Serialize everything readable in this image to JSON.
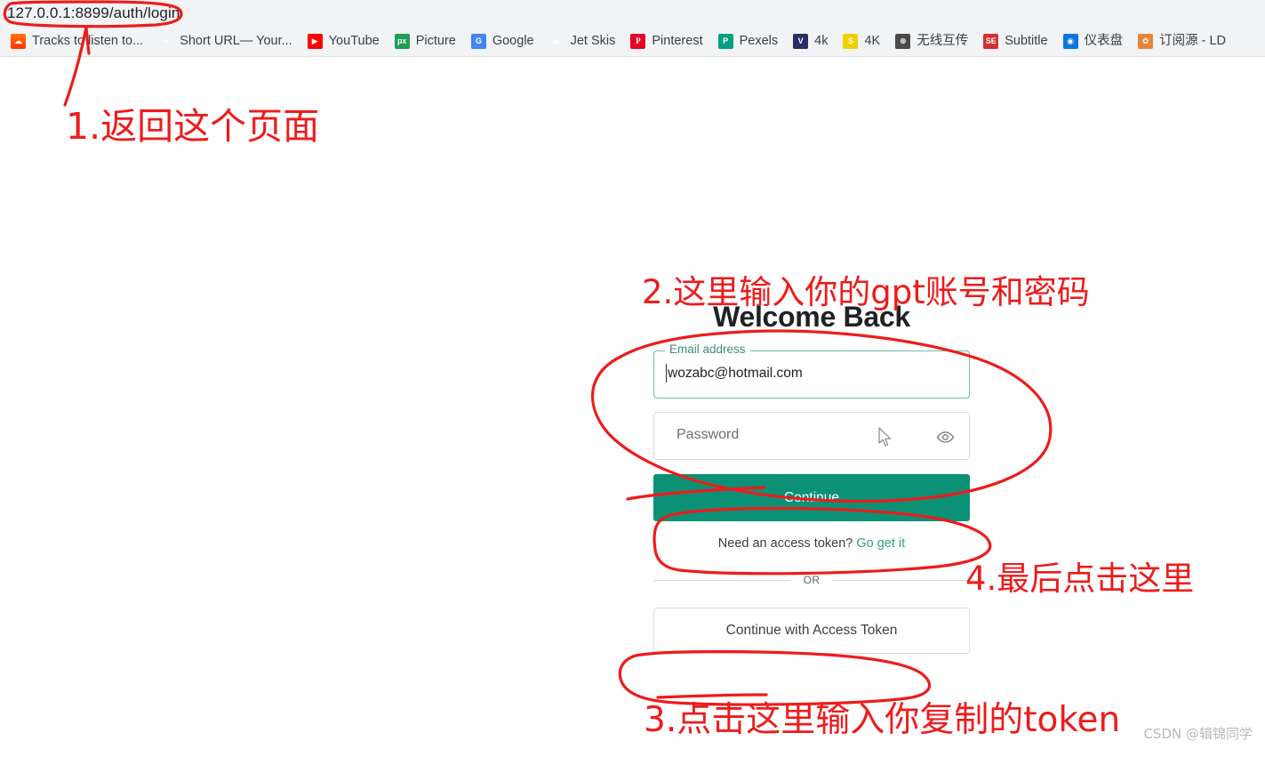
{
  "browser": {
    "url": "127.0.0.1:8899/auth/login",
    "bookmarks": [
      {
        "label": "Tracks to listen to...",
        "icon": "soundcloud-icon",
        "glyph": "☁",
        "cls": "fav-soundcloud"
      },
      {
        "label": "Short URL— Your...",
        "icon": "link-icon",
        "glyph": "∞",
        "cls": "fav-shorturl"
      },
      {
        "label": "YouTube",
        "icon": "youtube-icon",
        "glyph": "▶",
        "cls": "fav-youtube"
      },
      {
        "label": "Picture",
        "icon": "pexels-px-icon",
        "glyph": "px",
        "cls": "fav-picture"
      },
      {
        "label": "Google",
        "icon": "google-icon",
        "glyph": "G",
        "cls": "fav-google"
      },
      {
        "label": "Jet Skis",
        "icon": "play-icon",
        "glyph": "▶",
        "cls": "fav-jetski"
      },
      {
        "label": "Pinterest",
        "icon": "pinterest-icon",
        "glyph": "P",
        "cls": "fav-pinterest"
      },
      {
        "label": "Pexels",
        "icon": "pexels-icon",
        "glyph": "P",
        "cls": "fav-pexels"
      },
      {
        "label": "4k",
        "icon": "v-icon",
        "glyph": "V",
        "cls": "fav-4kv"
      },
      {
        "label": "4K",
        "icon": "s-badge-icon",
        "glyph": "S",
        "cls": "fav-4ks"
      },
      {
        "label": "无线互传",
        "icon": "globe-icon",
        "glyph": "⊕",
        "cls": "fav-wireless"
      },
      {
        "label": "Subtitle",
        "icon": "subtitle-icon",
        "glyph": "SE",
        "cls": "fav-subtitle"
      },
      {
        "label": "仪表盘",
        "icon": "dashboard-icon",
        "glyph": "◉",
        "cls": "fav-dashboard"
      },
      {
        "label": "订阅源 - LD",
        "icon": "rss-icon",
        "glyph": "✿",
        "cls": "fav-rss"
      }
    ]
  },
  "login": {
    "heading": "Welcome Back",
    "email": {
      "label": "Email address",
      "value": "wozabc@hotmail.com"
    },
    "password": {
      "placeholder": "Password",
      "toggle_icon": "eye-icon"
    },
    "continue_label": "Continue",
    "token_prompt": "Need an access token?",
    "token_link": "Go get it",
    "divider_label": "OR",
    "access_token_label": "Continue with Access Token"
  },
  "annotations": {
    "step1": "1.返回这个页面",
    "step2": "2.这里输入你的gpt账号和密码",
    "step3": "3.点击这里输入你复制的token",
    "step4": "4.最后点击这里",
    "color": "#ee1b1b"
  },
  "watermark": "CSDN @辑锦同学",
  "colors": {
    "primary_button": "#0b9175",
    "link": "#2f9e84",
    "field_focus_border": "#6fbca8",
    "annotation_red": "#ee1b1b"
  }
}
